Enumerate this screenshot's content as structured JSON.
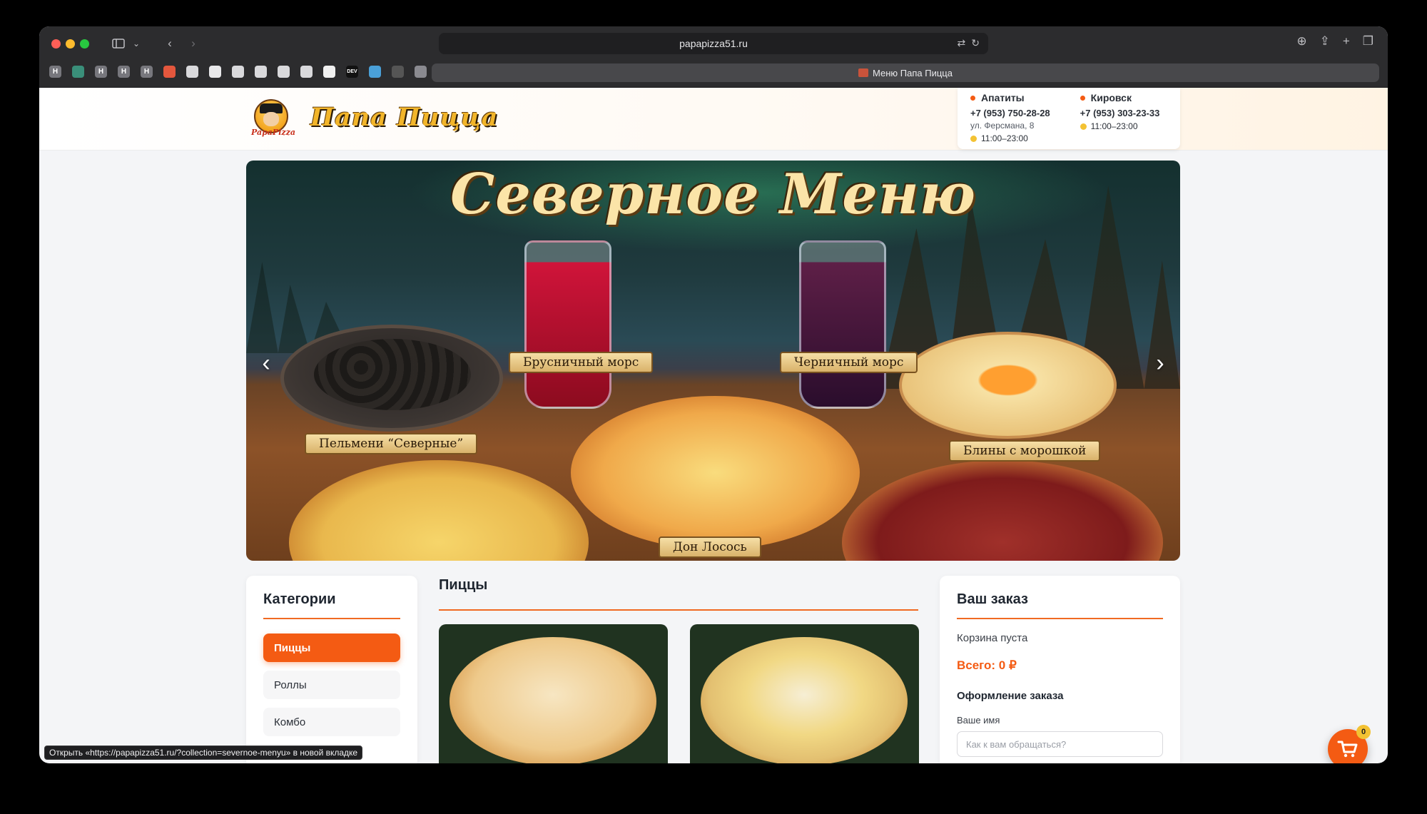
{
  "browser": {
    "url": "papapizza51.ru",
    "tab_title": "Меню Папа Пицца",
    "status_text": "Открыть «https://papapizza51.ru/?collection=severnoe-menyu» в новой вкладке",
    "favorites": [
      "H",
      "",
      "H",
      "H",
      "H",
      "",
      "",
      "",
      "",
      "",
      "",
      "",
      "",
      "DEV",
      "",
      "",
      ""
    ]
  },
  "header": {
    "logo_small": "PapaPizza",
    "logo_title": "Папа Пицца",
    "locations": [
      {
        "city": "Апатиты",
        "phone": "+7 (953) 750-28-28",
        "address": "ул. Ферсмана, 8",
        "hours": "11:00–23:00"
      },
      {
        "city": "Кировск",
        "phone": "+7 (953) 303-23-33",
        "address": "",
        "hours": "11:00–23:00"
      }
    ]
  },
  "banner": {
    "title": "Северное Меню",
    "labels": [
      "Брусничный морс",
      "Черничный морс",
      "Пельмени “Северные”",
      "Блины с морошкой",
      "Дон Лосось"
    ]
  },
  "categories": {
    "title": "Категории",
    "items": [
      "Пиццы",
      "Роллы",
      "Комбо"
    ],
    "active": "Пиццы"
  },
  "products": {
    "title": "Пиццы"
  },
  "order": {
    "title": "Ваш заказ",
    "empty_text": "Корзина пуста",
    "total": "Всего: 0 ₽",
    "checkout_title": "Оформление заказа",
    "name_label": "Ваше имя",
    "name_placeholder": "Как к вам обращаться?"
  },
  "cart_fab": {
    "count": "0"
  },
  "colors": {
    "accent": "#f45b13",
    "logo_gold": "#f2b52a",
    "badge": "#f3c233"
  }
}
